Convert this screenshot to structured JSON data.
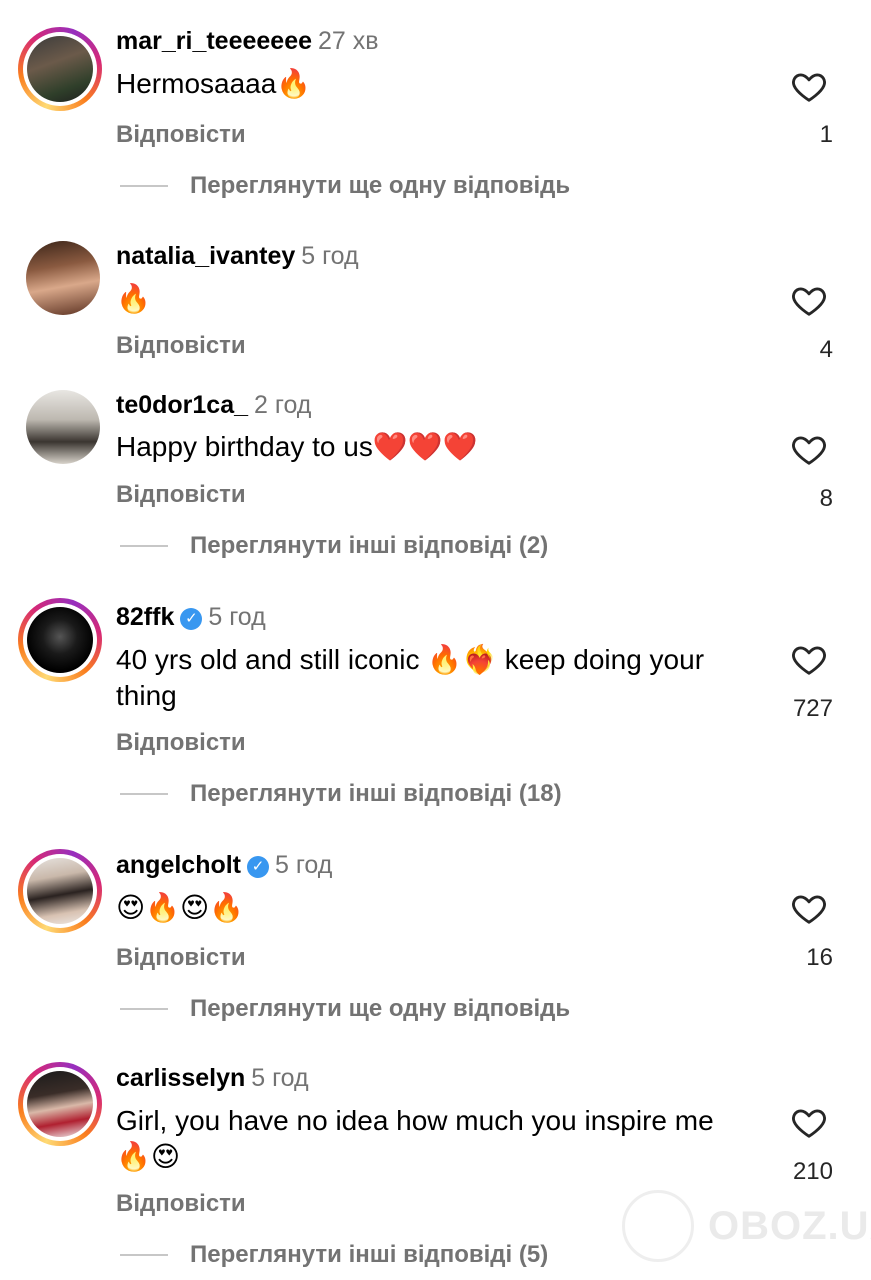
{
  "comments": [
    {
      "username": "mar_ri_teeeeeee",
      "time": "27 хв",
      "text": "Hermosaaaa🔥",
      "verified": false,
      "reply_label": "Відповісти",
      "likes": "1",
      "more_replies": "Переглянути ще одну відповідь"
    },
    {
      "username": "natalia_ivantey",
      "time": "5 год",
      "text": "🔥",
      "verified": false,
      "reply_label": "Відповісти",
      "likes": "4",
      "more_replies": ""
    },
    {
      "username": "te0dor1ca_",
      "time": "2 год",
      "text": "Happy birthday to us❤️❤️❤️",
      "verified": false,
      "reply_label": "Відповісти",
      "likes": "8",
      "more_replies": "Переглянути інші відповіді (2)"
    },
    {
      "username": "82ffk",
      "time": "5 год",
      "text": "40 yrs old and still iconic 🔥❤️‍🔥 keep doing your thing",
      "verified": true,
      "reply_label": "Відповісти",
      "likes": "727",
      "more_replies": "Переглянути інші відповіді (18)"
    },
    {
      "username": "angelcholt",
      "time": "5 год",
      "text": "😍🔥😍🔥",
      "verified": true,
      "reply_label": "Відповісти",
      "likes": "16",
      "more_replies": "Переглянути ще одну відповідь"
    },
    {
      "username": "carlisselyn",
      "time": "5 год",
      "text": "Girl, you have no idea how much you inspire me 🔥😍",
      "verified": false,
      "reply_label": "Відповісти",
      "likes": "210",
      "more_replies": "Переглянути інші відповіді (5)"
    }
  ],
  "watermark": "OBOZ.UA",
  "icons": {
    "like": "heart-outline-icon",
    "verified": "verified-badge-icon"
  },
  "colors": {
    "ring_start": "#feda75",
    "ring_mid": "#d62976",
    "verified": "#3897f0",
    "secondary_text": "#737373"
  }
}
